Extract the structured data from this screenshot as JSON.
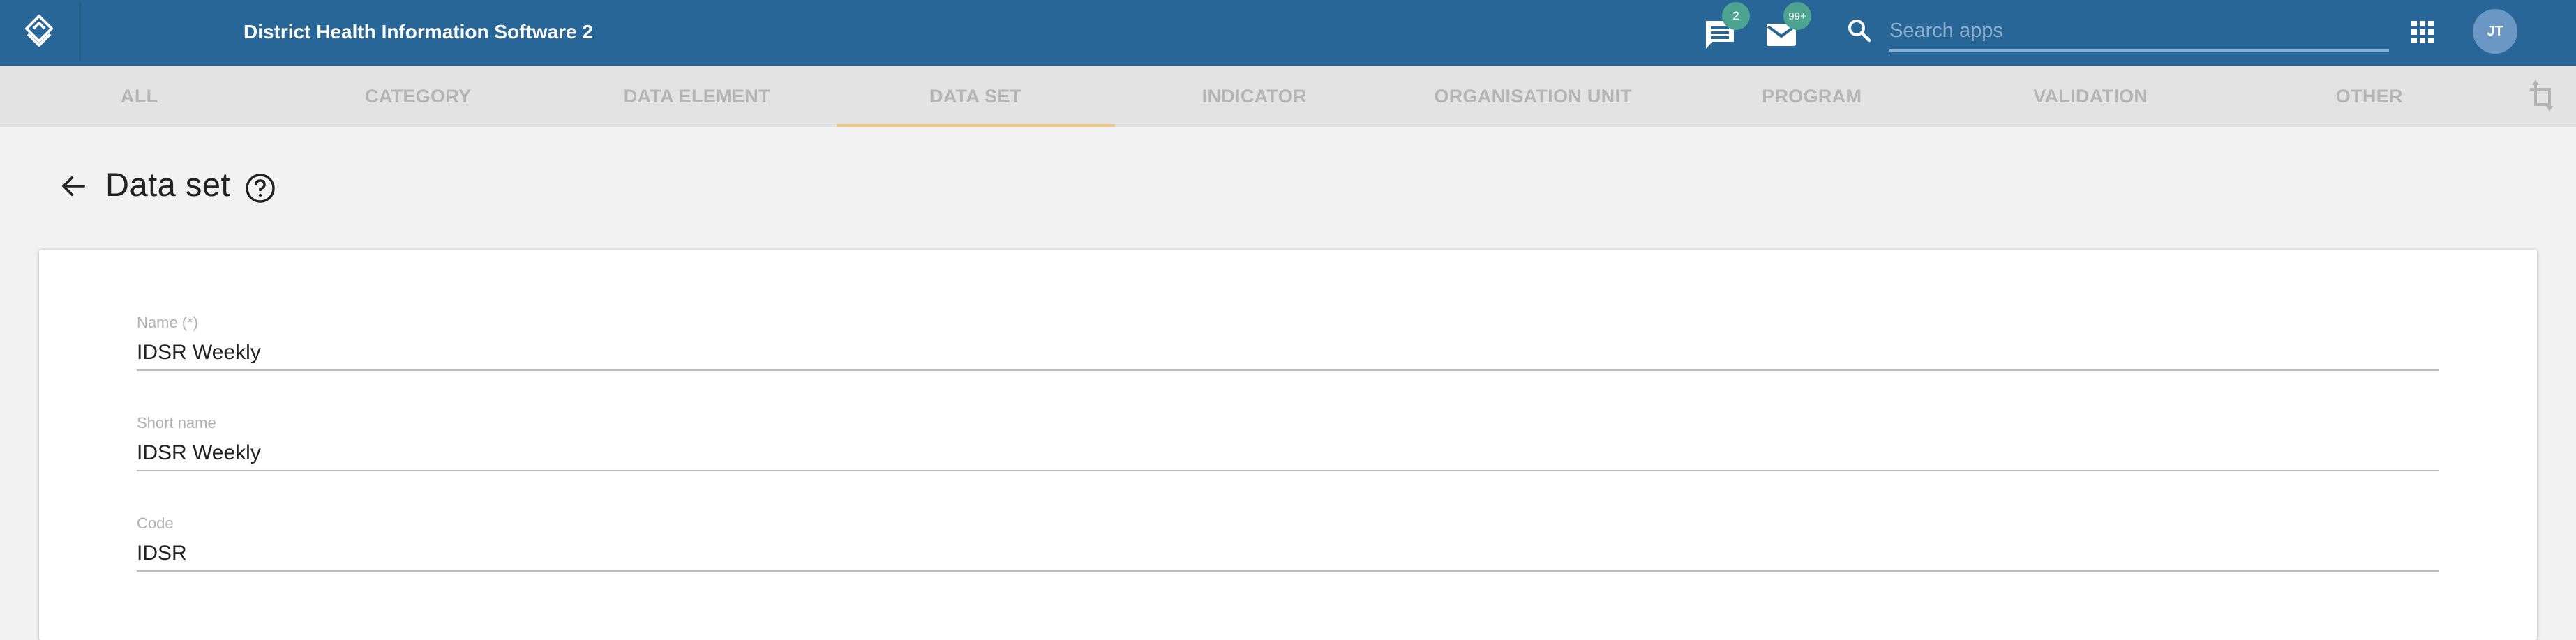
{
  "header": {
    "title": "District Health Information Software 2",
    "messages_badge": "2",
    "mail_badge": "99+",
    "search_placeholder": "Search apps",
    "search_value": "",
    "avatar_initials": "JT",
    "colors": {
      "bar": "#276696",
      "badge": "#4ca38f",
      "avatar": "#6b97c4"
    }
  },
  "tabs": {
    "items": [
      {
        "label": "ALL",
        "active": false
      },
      {
        "label": "CATEGORY",
        "active": false
      },
      {
        "label": "DATA ELEMENT",
        "active": false
      },
      {
        "label": "DATA SET",
        "active": true
      },
      {
        "label": "INDICATOR",
        "active": false
      },
      {
        "label": "ORGANISATION UNIT",
        "active": false
      },
      {
        "label": "PROGRAM",
        "active": false
      },
      {
        "label": "VALIDATION",
        "active": false
      },
      {
        "label": "OTHER",
        "active": false
      }
    ],
    "active_color": "#efc68a"
  },
  "page": {
    "title": "Data set"
  },
  "form": {
    "fields": [
      {
        "label": "Name (*)",
        "value": "IDSR Weekly"
      },
      {
        "label": "Short name",
        "value": "IDSR Weekly"
      },
      {
        "label": "Code",
        "value": "IDSR"
      }
    ]
  }
}
